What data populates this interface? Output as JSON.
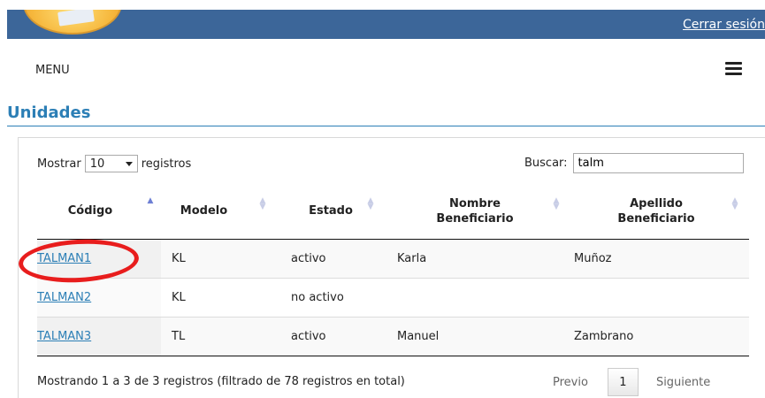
{
  "header": {
    "logout_label": "Cerrar sesión"
  },
  "menu": {
    "label": "MENU"
  },
  "page": {
    "title": "Unidades"
  },
  "controls": {
    "length_prefix": "Mostrar",
    "length_value": "10",
    "length_suffix": "registros",
    "search_label": "Buscar:",
    "search_value": "talm"
  },
  "table": {
    "columns": [
      {
        "label": "Código",
        "sort": "asc"
      },
      {
        "label": "Modelo",
        "sort": "both"
      },
      {
        "label": "Estado",
        "sort": "both"
      },
      {
        "label": "Nombre Beneficiario",
        "sort": "both"
      },
      {
        "label": "Apellido Beneficiario",
        "sort": "both"
      }
    ],
    "rows": [
      [
        "TALMAN1",
        "KL",
        "activo",
        "Karla",
        "Muñoz"
      ],
      [
        "TALMAN2",
        "KL",
        "no activo",
        "",
        ""
      ],
      [
        "TALMAN3",
        "TL",
        "activo",
        "Manuel",
        "Zambrano"
      ]
    ]
  },
  "footer": {
    "info": "Mostrando 1 a 3 de 3 registros (filtrado de 78 registros en total)",
    "prev_label": "Previo",
    "page": "1",
    "next_label": "Siguiente"
  },
  "colors": {
    "header_bar": "#3c6699",
    "accent": "#2c7fb6",
    "highlight": "#e81d1d"
  }
}
